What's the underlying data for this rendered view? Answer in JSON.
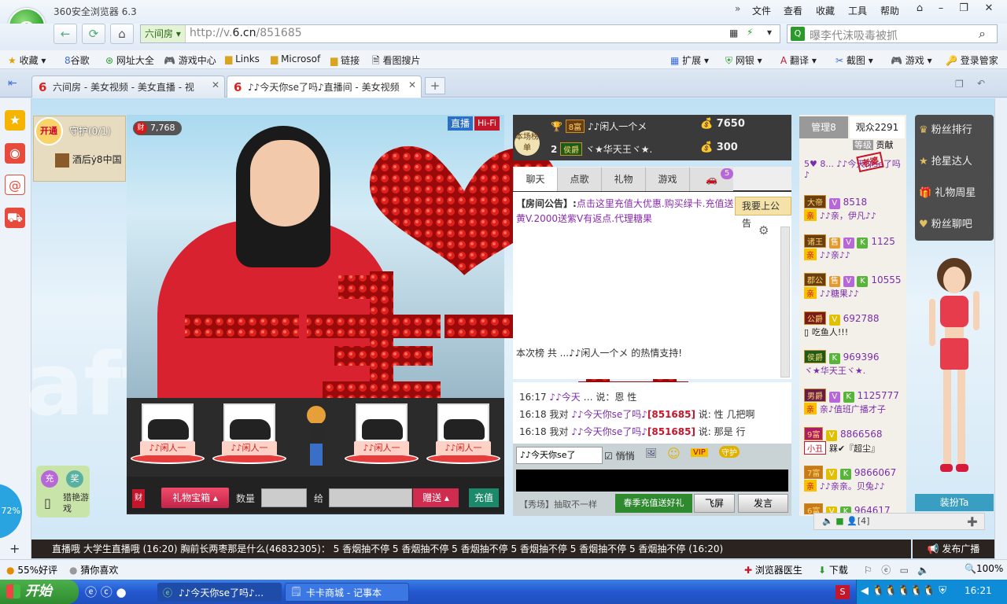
{
  "browser": {
    "title": "360安全浏览器 6.3",
    "menu": [
      "文件",
      "查看",
      "收藏",
      "工具",
      "帮助"
    ],
    "address": {
      "tag": "六间房",
      "url_prefix": "http://v.",
      "url_domain": "6.cn",
      "url_path": "/851685"
    },
    "search_value": "曝李代沫吸毒被抓",
    "bookmarks": [
      "收藏",
      "谷歌",
      "网址大全",
      "游戏中心",
      "Links",
      "Microsof",
      "链接",
      "看图搜片",
      "扩展",
      "网银",
      "翻译",
      "截图",
      "游戏",
      "登录管家"
    ],
    "tabs": [
      {
        "label": "六间房 - 美女视频 - 美女直播 - 视"
      },
      {
        "label": "♪♪今天你se了吗♪直播间 - 美女视频"
      }
    ]
  },
  "stream": {
    "wealth_count": "7,768",
    "live_label": "直播",
    "hifi_label": "Hi-Fi",
    "kaitong": "开通",
    "guard_label": "守护(0/1)",
    "host_item": "酒后ẏ8中国",
    "cars": [
      "♪♪闲人一",
      "♪♪闲人一",
      "♪♪闲人一",
      "♪♪闲人一"
    ],
    "gift_box": "礼物宝箱",
    "qty_label": "数量",
    "to_label": "给",
    "send_gift": "赠送",
    "recharge": "充值",
    "cai_label": "财"
  },
  "rank": {
    "badge": "本场榜单",
    "rows": [
      {
        "rank": "",
        "level": "8富",
        "name": "♪♪闲人一个メ",
        "value": "7650"
      },
      {
        "rank": "2",
        "level": "侯爵",
        "name": "ヾ★华天王ヾ★.",
        "value": "300"
      }
    ]
  },
  "chat": {
    "tabs": [
      "聊天",
      "点歌",
      "礼物",
      "游戏",
      "🚗"
    ],
    "car_badge": "5",
    "notice_prefix": "【房间公告】:",
    "notice_text": "点击这里充值大优惠.购买绿卡.充值送黄V.2000送紫V有返点.代理糖果",
    "notice_button": "我要上公告",
    "thanks_line": "本次榜 共 ...♪♪闲人一个メ 的热情支持!",
    "lines": [
      {
        "time": "16:17",
        "user": "♪♪今天",
        "tail": "说：恩 性"
      },
      {
        "time": "16:18",
        "pre": "我对",
        "user": "♪♪今天你se了吗♪",
        "room": "[851685]",
        "tail": "说: 性  几把啊"
      },
      {
        "time": "16:18",
        "pre": "我对",
        "user": "♪♪今天你se了吗♪",
        "room": "[851685]",
        "tail": "说: 那是 行"
      }
    ],
    "target": "♪♪今天你se了",
    "whisper": "悄悄",
    "show_label": "【秀场】抽取不一样",
    "spring": "春季充值送好礼",
    "fly": "飞屏",
    "send": "发言"
  },
  "audience": {
    "tab_manager": "管理8",
    "tab_viewers": "观众2291",
    "tab_level": "等级",
    "tab_contrib": "贡献",
    "top_msg": "5♥ 8... ♪♪今天你se了吗♪",
    "stamp": "老婆",
    "rows": [
      {
        "level": "大帝",
        "num": "8518",
        "msg": "♪♪亲，伊凡♪♪"
      },
      {
        "level": "诸王",
        "num": "1125",
        "msg": "♪♪亲♪♪"
      },
      {
        "level": "郡公",
        "num": "10555",
        "msg": "♪♪糖果♪♪"
      },
      {
        "level": "公爵",
        "num": "692788",
        "msg": "吃鱼人!!!"
      },
      {
        "level": "侯爵",
        "num": "969396",
        "msg": "ヾ★华天王ヾ★."
      },
      {
        "level": "男爵",
        "num": "1125777",
        "msg": "亲♪值班广播才子"
      },
      {
        "level": "9富",
        "num": "8866568",
        "msg": "槑✔『超尘』"
      },
      {
        "level": "7富",
        "num": "9866067",
        "msg": "♪♪亲亲。贝兔♪♪"
      },
      {
        "level": "6富",
        "num": "964617",
        "msg": ""
      }
    ],
    "count_footer": "[4]"
  },
  "side": {
    "items": [
      "粉丝排行",
      "抢星达人",
      "礼物周星",
      "粉丝聊吧"
    ],
    "dress": "装扮Ta",
    "charge": "充",
    "prize": "奖",
    "game": "猎艳游戏",
    "zoom_pct": "72%"
  },
  "ticker": {
    "text": "直播哦 大学生直播哦 (16:20)    胸前长两枣那是什么(46832305)： 5 香烟抽不停 5 香烟抽不停 5 香烟抽不停 5 香烟抽不停 5 香烟抽不停 5 香烟抽不停 (16:20)",
    "broadcast": "发布广播"
  },
  "status": {
    "good": "55%好评",
    "guess": "猜你喜欢",
    "doctor": "浏览器医生",
    "download": "下载",
    "zoom": "100%"
  },
  "taskbar": {
    "start": "开始",
    "tasks": [
      "♪♪今天你se了吗♪...",
      "卡卡商城 - 记事本"
    ],
    "time": "16:21"
  }
}
